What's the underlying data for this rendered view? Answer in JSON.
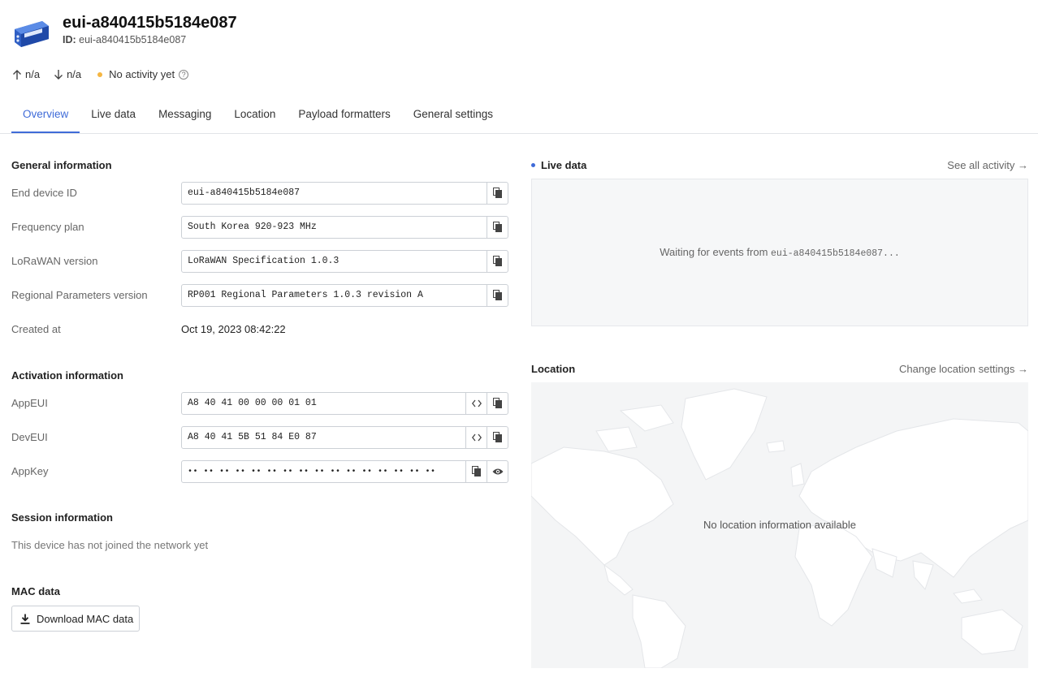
{
  "device": {
    "title": "eui-a840415b5184e087",
    "id_label": "ID:",
    "id_value": "eui-a840415b5184e087"
  },
  "stats": {
    "uplink": "n/a",
    "downlink": "n/a",
    "activity": "No activity yet"
  },
  "tabs": [
    "Overview",
    "Live data",
    "Messaging",
    "Location",
    "Payload formatters",
    "General settings"
  ],
  "general": {
    "title": "General information",
    "end_device_id_label": "End device ID",
    "end_device_id": "eui-a840415b5184e087",
    "frequency_plan_label": "Frequency plan",
    "frequency_plan": "South Korea 920-923 MHz",
    "lorawan_version_label": "LoRaWAN version",
    "lorawan_version": "LoRaWAN Specification 1.0.3",
    "regional_label": "Regional Parameters version",
    "regional": "RP001 Regional Parameters 1.0.3 revision A",
    "created_label": "Created at",
    "created": "Oct 19, 2023 08:42:22"
  },
  "activation": {
    "title": "Activation information",
    "appeui_label": "AppEUI",
    "appeui": "A8 40 41 00 00 00 01 01",
    "deveui_label": "DevEUI",
    "deveui": "A8 40 41 5B 51 84 E0 87",
    "appkey_label": "AppKey",
    "appkey": "•• •• •• •• •• •• •• •• •• •• •• •• •• •• •• ••"
  },
  "session": {
    "title": "Session information",
    "note": "This device has not joined the network yet"
  },
  "mac": {
    "title": "MAC data",
    "download_label": "Download MAC data"
  },
  "live_data": {
    "title": "Live data",
    "link": "See all activity →",
    "waiting_prefix": "Waiting for events from ",
    "waiting_device": "eui-a840415b5184e087...",
    "accent": "#3f6bd8"
  },
  "location": {
    "title": "Location",
    "link": "Change location settings →",
    "message": "No location information available"
  },
  "colors": {
    "active_tab": "#3f6bd8",
    "status_dot": "#f5b642"
  }
}
